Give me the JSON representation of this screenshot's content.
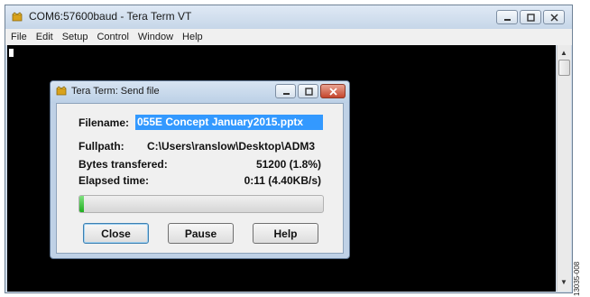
{
  "window": {
    "title": "COM6:57600baud - Tera Term VT",
    "menu": [
      "File",
      "Edit",
      "Setup",
      "Control",
      "Window",
      "Help"
    ]
  },
  "dialog": {
    "title": "Tera Term: Send file",
    "filename_label": "Filename:",
    "filename_value": "055E Concept January2015.pptx",
    "fullpath_label": "Fullpath:",
    "fullpath_value": "C:\\Users\\ranslow\\Desktop\\ADM3",
    "bytes_label": "Bytes transfered:",
    "bytes_value": "51200 (1.8%)",
    "elapsed_label": "Elapsed time:",
    "elapsed_value": "0:11 (4.40KB/s)",
    "progress_percent": 1.8,
    "buttons": {
      "close": "Close",
      "pause": "Pause",
      "help": "Help"
    }
  },
  "figure_id": "13035-008",
  "icons": {
    "app": "tera-term-icon",
    "minimize": "minimize-icon",
    "maximize": "maximize-icon",
    "close": "close-icon"
  },
  "colors": {
    "selection": "#3399ff",
    "progress": "#1fae1f",
    "terminal_bg": "#000000",
    "close_button": "#c4452d"
  }
}
